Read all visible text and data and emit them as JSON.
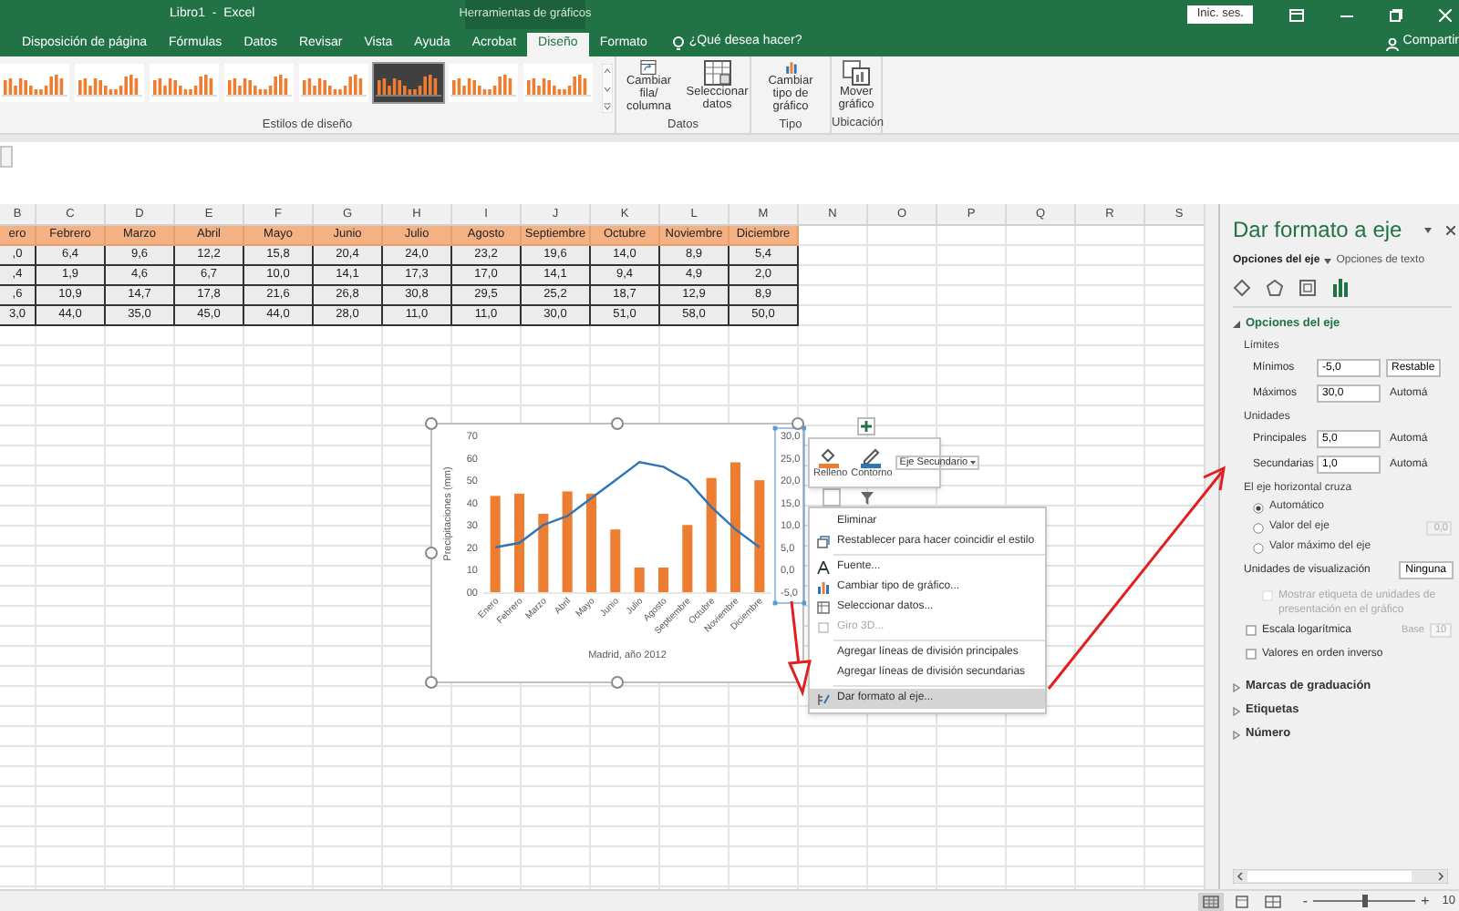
{
  "window": {
    "title": "Libro1  -  Excel",
    "context_title": "Herramientas de gráficos",
    "sign_in": "Inic. ses."
  },
  "tabs": [
    {
      "label": "Disposición de página",
      "selected": false
    },
    {
      "label": "Fórmulas",
      "selected": false
    },
    {
      "label": "Datos",
      "selected": false
    },
    {
      "label": "Revisar",
      "selected": false
    },
    {
      "label": "Vista",
      "selected": false
    },
    {
      "label": "Ayuda",
      "selected": false
    },
    {
      "label": "Acrobat",
      "selected": false
    },
    {
      "label": "Diseño",
      "selected": true
    },
    {
      "label": "Formato",
      "selected": false
    }
  ],
  "tell_me": "¿Qué desea hacer?",
  "share": "Compartir",
  "ribbon": {
    "chart_styles": [
      {
        "selected": false
      },
      {
        "selected": false
      },
      {
        "selected": false
      },
      {
        "selected": false
      },
      {
        "selected": false
      },
      {
        "selected": true
      },
      {
        "selected": false
      },
      {
        "selected": false
      }
    ],
    "gallery_label": "Estilos de diseño",
    "groups": [
      {
        "label": "Datos",
        "buttons": [
          "Cambiar fila/ columna",
          "Seleccionar datos"
        ]
      },
      {
        "label": "Tipo",
        "buttons": [
          "Cambiar tipo de gráfico"
        ]
      },
      {
        "label": "Ubicación",
        "buttons": [
          "Mover gráfico"
        ]
      }
    ]
  },
  "sheet": {
    "columns": [
      "B",
      "C",
      "D",
      "E",
      "F",
      "G",
      "H",
      "I",
      "J",
      "K",
      "L",
      "M",
      "N",
      "O",
      "P",
      "Q",
      "R",
      "S"
    ],
    "rows": [
      {
        "kind": "header",
        "cells": [
          "ero",
          "Febrero",
          "Marzo",
          "Abril",
          "Mayo",
          "Junio",
          "Julio",
          "Agosto",
          "Septiembre",
          "Octubre",
          "Noviembre",
          "Diciembre"
        ]
      },
      {
        "kind": "data",
        "cells": [
          ",0",
          "6,4",
          "9,6",
          "12,2",
          "15,8",
          "20,4",
          "24,0",
          "23,2",
          "19,6",
          "14,0",
          "8,9",
          "5,4"
        ]
      },
      {
        "kind": "data",
        "cells": [
          ",4",
          "1,9",
          "4,6",
          "6,7",
          "10,0",
          "14,1",
          "17,3",
          "17,0",
          "14,1",
          "9,4",
          "4,9",
          "2,0"
        ]
      },
      {
        "kind": "data",
        "cells": [
          ",6",
          "10,9",
          "14,7",
          "17,8",
          "21,6",
          "26,8",
          "30,8",
          "29,5",
          "25,2",
          "18,7",
          "12,9",
          "8,9"
        ]
      },
      {
        "kind": "data",
        "cells": [
          "3,0",
          "44,0",
          "35,0",
          "45,0",
          "44,0",
          "28,0",
          "11,0",
          "11,0",
          "30,0",
          "51,0",
          "58,0",
          "50,0"
        ]
      }
    ]
  },
  "chart": {
    "secondary_axis_selected": true,
    "chart_data": {
      "type": "bar",
      "xlabel": "Madrid, año 2012",
      "ylabel": "Precipitaciones (mm)",
      "categories": [
        "Enero",
        "Febrero",
        "Marzo",
        "Abril",
        "Mayo",
        "Junio",
        "Julio",
        "Agosto",
        "Septiembre",
        "Octubre",
        "Noviembre",
        "Diciembre"
      ],
      "series": [
        {
          "type": "bar",
          "color": "#ed7d31",
          "values": [
            43,
            44,
            35,
            45,
            44,
            28,
            11,
            11,
            30,
            51,
            58,
            50
          ]
        },
        {
          "type": "line",
          "color": "#2e75b6",
          "axis": "y2",
          "values": [
            5,
            6,
            10,
            12,
            16,
            20,
            24,
            23,
            20,
            14,
            9,
            5
          ]
        }
      ],
      "ylim": [
        0,
        70
      ],
      "yticks": [
        {
          "value": 0,
          "label": "00"
        },
        10,
        20,
        30,
        40,
        50,
        60,
        70
      ],
      "y2lim": [
        -5,
        30
      ],
      "y2ticks": [
        {
          "value": -5,
          "label": "-5,0"
        },
        {
          "value": 0,
          "label": "0,0"
        },
        {
          "value": 5,
          "label": "5,0"
        },
        {
          "value": 10,
          "label": "10,0"
        },
        {
          "value": 15,
          "label": "15,0"
        },
        {
          "value": 20,
          "label": "20,0"
        },
        {
          "value": 25,
          "label": "25,0"
        },
        {
          "value": 30,
          "label": "30,0"
        }
      ]
    }
  },
  "mini_toolbar": {
    "fill": "Relleno",
    "outline": "Contorno",
    "element": "Eje Secundario"
  },
  "context_menu": [
    {
      "label": "Eliminar",
      "disabled": false,
      "selected": false
    },
    {
      "label": "Restablecer para hacer coincidir el estilo",
      "disabled": false,
      "selected": false,
      "separator_after": true
    },
    {
      "label": "Fuente...",
      "disabled": false,
      "selected": false
    },
    {
      "label": "Cambiar tipo de gráfico...",
      "disabled": false,
      "selected": false
    },
    {
      "label": "Seleccionar datos...",
      "disabled": false,
      "selected": false
    },
    {
      "label": "Giro 3D...",
      "disabled": true,
      "selected": false,
      "separator_after": true
    },
    {
      "label": "Agregar líneas de división principales",
      "disabled": false,
      "selected": false
    },
    {
      "label": "Agregar líneas de división secundarias",
      "disabled": false,
      "selected": false,
      "separator_after": true
    },
    {
      "label": "Dar formato al eje...",
      "disabled": false,
      "selected": true
    }
  ],
  "panel": {
    "title": "Dar formato a eje",
    "tabs": [
      {
        "label": "Opciones del eje",
        "selected": true
      },
      {
        "label": "Opciones de texto",
        "selected": false
      }
    ],
    "icon_tabs": [
      {
        "selected": false
      },
      {
        "selected": false
      },
      {
        "selected": false
      },
      {
        "selected": true
      }
    ],
    "section": {
      "label": "Opciones del eje",
      "expanded": true
    },
    "items": [
      {
        "kind": "heading",
        "label": "Límites"
      },
      {
        "kind": "field",
        "label": "Mínimos",
        "value": "-5,0",
        "button": "Restable"
      },
      {
        "kind": "field",
        "label": "Máximos",
        "value": "30,0",
        "note": "Automá"
      },
      {
        "kind": "heading",
        "label": "Unidades"
      },
      {
        "kind": "field",
        "label": "Principales",
        "value": "5,0",
        "note": "Automá"
      },
      {
        "kind": "field",
        "label": "Secundarias",
        "value": "1,0",
        "note": "Automá"
      },
      {
        "kind": "heading",
        "label": "El eje horizontal cruza"
      },
      {
        "kind": "radio",
        "label": "Automático",
        "selected": true
      },
      {
        "kind": "radio",
        "label": "Valor del eje",
        "selected": false,
        "value": "0,0"
      },
      {
        "kind": "radio",
        "label": "Valor máximo del eje",
        "selected": false
      },
      {
        "kind": "dropdown",
        "label": "Unidades de visualización",
        "value": "Ninguna"
      },
      {
        "kind": "checkbox",
        "label": "Mostrar etiqueta de unidades de presentación en el gráfico",
        "checked": false,
        "disabled": true
      },
      {
        "kind": "checkbox",
        "label": "Escala logarítmica",
        "checked": false,
        "disabled": false,
        "extra_label": "Base",
        "value": "10"
      },
      {
        "kind": "checkbox",
        "label": "Valores en orden inverso",
        "checked": false,
        "disabled": false
      }
    ],
    "collapsed_sections": [
      {
        "label": "Marcas de graduación",
        "expanded": false
      },
      {
        "label": "Etiquetas",
        "expanded": false
      },
      {
        "label": "Número",
        "expanded": false
      }
    ]
  },
  "status_bar": {
    "views": [
      {
        "selected": true
      },
      {
        "selected": false
      },
      {
        "selected": false
      }
    ],
    "zoom_out": "-",
    "zoom_in": "+",
    "level": 0.5,
    "zoom": "10"
  }
}
